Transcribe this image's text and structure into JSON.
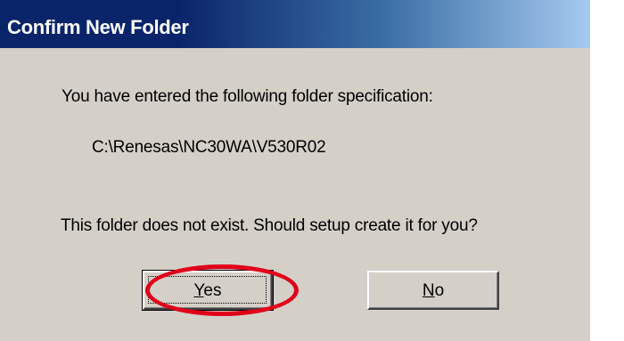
{
  "window": {
    "title": "Confirm New Folder"
  },
  "message": {
    "line1": "You have entered the following folder specification:",
    "folder_path": "C:\\Renesas\\NC30WA\\V530R02",
    "line2": "This folder does not exist.  Should setup create it for you?"
  },
  "buttons": {
    "yes": {
      "mnemonic": "Y",
      "rest": "es"
    },
    "no": {
      "mnemonic": "N",
      "rest": "o"
    }
  },
  "annotation": {
    "highlight_color": "#e0001a",
    "highlight_target": "yes-button"
  },
  "colors": {
    "titlebar_start": "#0a246a",
    "titlebar_end": "#a6caf0",
    "dialog_face": "#d4d0c8"
  }
}
